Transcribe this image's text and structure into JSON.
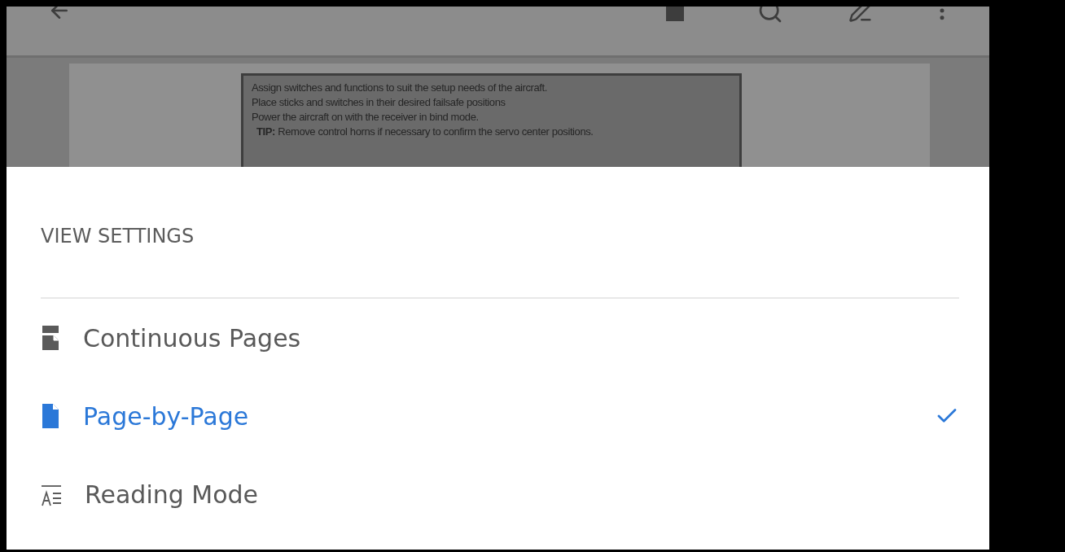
{
  "document": {
    "lines": [
      "Assign switches and functions to suit the setup needs of the aircraft.",
      "Place sticks and switches in their desired failsafe positions",
      "Power the aircraft on with the receiver in bind mode.",
      "**TIP:** Remove control horns if necessary to confirm the servo center positions."
    ]
  },
  "view_settings": {
    "title": "VIEW SETTINGS",
    "options": [
      {
        "label": "Continuous Pages",
        "kind": "continuous",
        "selected": false
      },
      {
        "label": "Page-by-Page",
        "kind": "single",
        "selected": true
      },
      {
        "label": "Reading Mode",
        "kind": "reading",
        "selected": false
      }
    ]
  }
}
